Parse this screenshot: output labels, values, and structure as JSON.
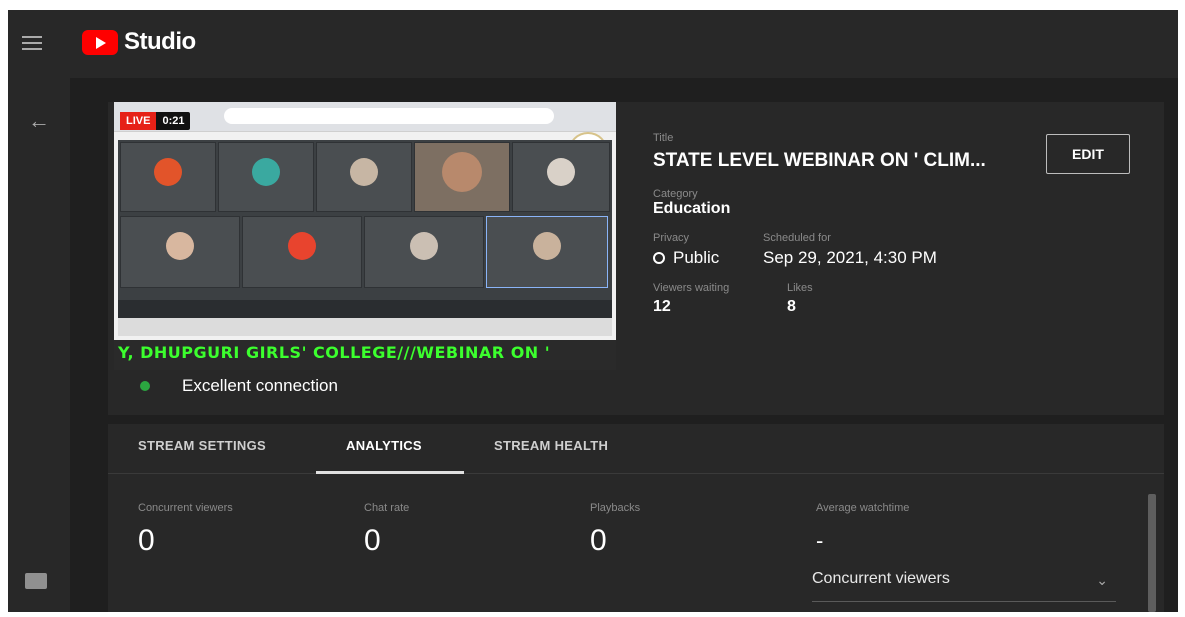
{
  "app": {
    "name": "Studio"
  },
  "preview": {
    "live_label": "LIVE",
    "live_time": "0:21",
    "ticker_text": "Y, DHUPGURI GIRLS' COLLEGE///WEBINAR ON '"
  },
  "stream": {
    "title_label": "Title",
    "title_value": "STATE LEVEL WEBINAR ON ' CLIM...",
    "category_label": "Category",
    "category_value": "Education",
    "privacy_label": "Privacy",
    "privacy_value": "Public",
    "scheduled_label": "Scheduled for",
    "scheduled_value": "Sep 29, 2021, 4:30 PM",
    "viewers_waiting_label": "Viewers waiting",
    "viewers_waiting_value": "12",
    "likes_label": "Likes",
    "likes_value": "8",
    "edit_label": "EDIT",
    "connection_text": "Excellent connection"
  },
  "tabs": [
    {
      "label": "STREAM SETTINGS"
    },
    {
      "label": "ANALYTICS"
    },
    {
      "label": "STREAM HEALTH"
    }
  ],
  "analytics": {
    "concurrent_label": "Concurrent viewers",
    "concurrent_value": "0",
    "chat_label": "Chat rate",
    "chat_value": "0",
    "playbacks_label": "Playbacks",
    "playbacks_value": "0",
    "watchtime_label": "Average watchtime",
    "watchtime_value": "-",
    "dropdown_value": "Concurrent viewers"
  },
  "icons": {
    "menu": "hamburger-icon",
    "back": "arrow-left-icon",
    "feedback": "feedback-icon",
    "privacy": "globe-icon",
    "dropdown": "chevron-down-icon"
  },
  "colors": {
    "brand_red": "#ff0000",
    "live_red": "#e62117",
    "connection_green": "#2ba640",
    "ticker_green": "#3cff2e"
  }
}
